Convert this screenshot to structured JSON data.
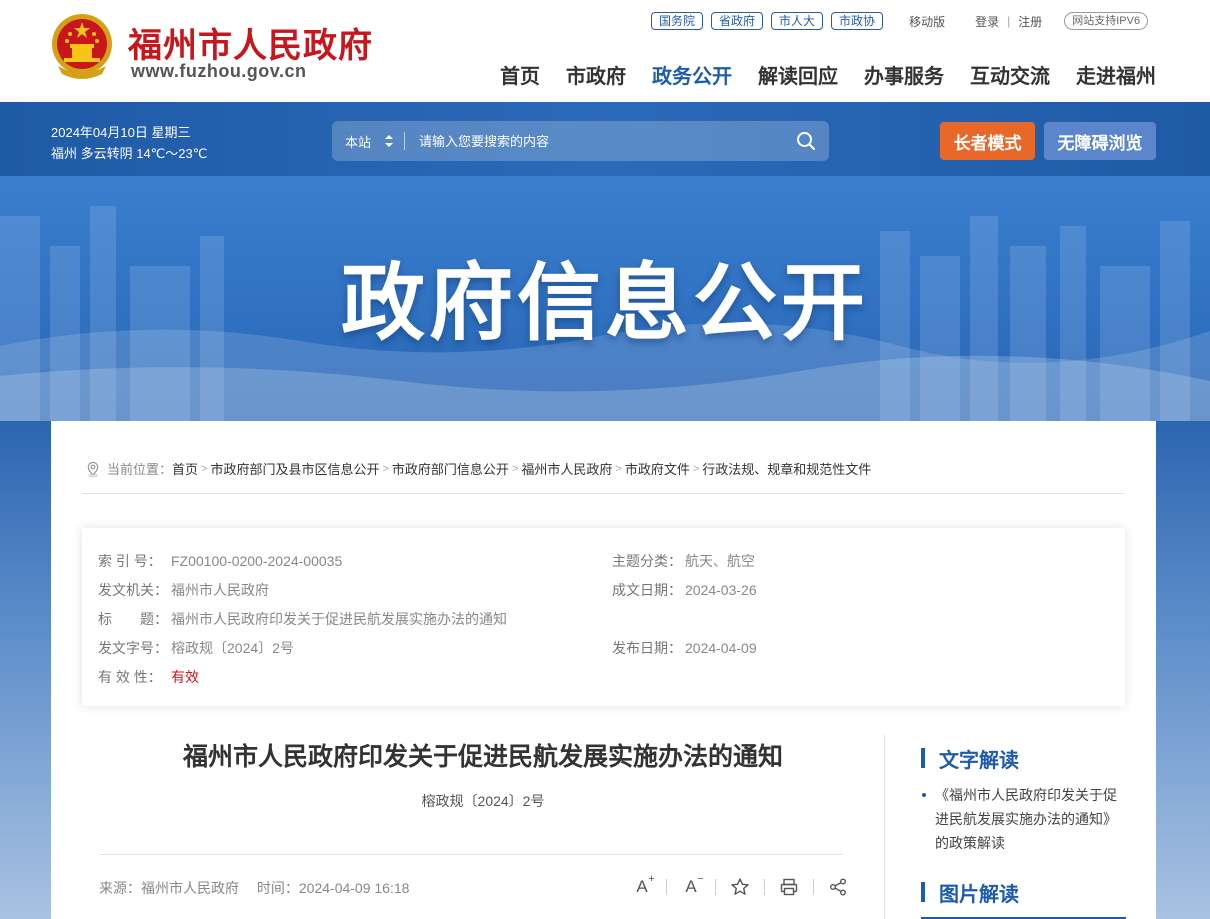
{
  "header": {
    "site_name": "福州市人民政府",
    "site_url": "www.fuzhou.gov.cn",
    "top_tags": [
      "国务院",
      "省政府",
      "市人大",
      "市政协"
    ],
    "mobile": "移动版",
    "login": "登录",
    "separator": "|",
    "register": "注册",
    "ipv6": "网站支持IPV6",
    "nav": [
      "首页",
      "市政府",
      "政务公开",
      "解读回应",
      "办事服务",
      "互动交流",
      "走进福州"
    ],
    "nav_active": "政务公开"
  },
  "info_bar": {
    "date": "2024年04月10日 星期三",
    "weather": "福州 多云转阴 14℃～23℃",
    "search_scope": "本站",
    "search_placeholder": "请输入您要搜索的内容",
    "elder_mode": "长者模式",
    "accessible": "无障碍浏览"
  },
  "banner": {
    "title": "政府信息公开"
  },
  "breadcrumb": {
    "prefix": "当前位置：",
    "items": [
      "首页",
      "市政府部门及县市区信息公开",
      "市政府部门信息公开",
      "福州市人民政府",
      "市政府文件",
      "行政法规、规章和规范性文件"
    ],
    "sep": ">"
  },
  "meta": {
    "index_label": "索 引 号：",
    "index_value": "FZ00100-0200-2024-00035",
    "topic_label": "主题分类：",
    "topic_value": "航天、航空",
    "issuer_label": "发文机关：",
    "issuer_value": "福州市人民政府",
    "created_label": "成文日期：",
    "created_value": "2024-03-26",
    "title_label": "标　　题：",
    "title_value": "福州市人民政府印发关于促进民航发展实施办法的通知",
    "docno_label": "发文字号：",
    "docno_value": "榕政规〔2024〕2号",
    "published_label": "发布日期：",
    "published_value": "2024-04-09",
    "validity_label": "有 效 性：",
    "validity_value": "有效"
  },
  "article": {
    "title": "福州市人民政府印发关于促进民航发展实施办法的通知",
    "docno": "榕政规〔2024〕2号",
    "source_label": "来源：",
    "source_value": "福州市人民政府",
    "time_label": "时间：",
    "time_value": "2024-04-09 16:18",
    "tools": {
      "font_larger": "A",
      "font_larger_mark": "+",
      "font_smaller": "A",
      "font_smaller_mark": "−"
    }
  },
  "sidebar": {
    "text_reading_title": "文字解读",
    "text_reading_item": "《福州市人民政府印发关于促进民航发展实施办法的通知》的政策解读",
    "image_reading_title": "图片解读"
  },
  "colors": {
    "brand_red": "#c8161d",
    "brand_blue": "#1d5bab",
    "elder_orange": "#e8682a",
    "validity_red": "#d0161b"
  }
}
